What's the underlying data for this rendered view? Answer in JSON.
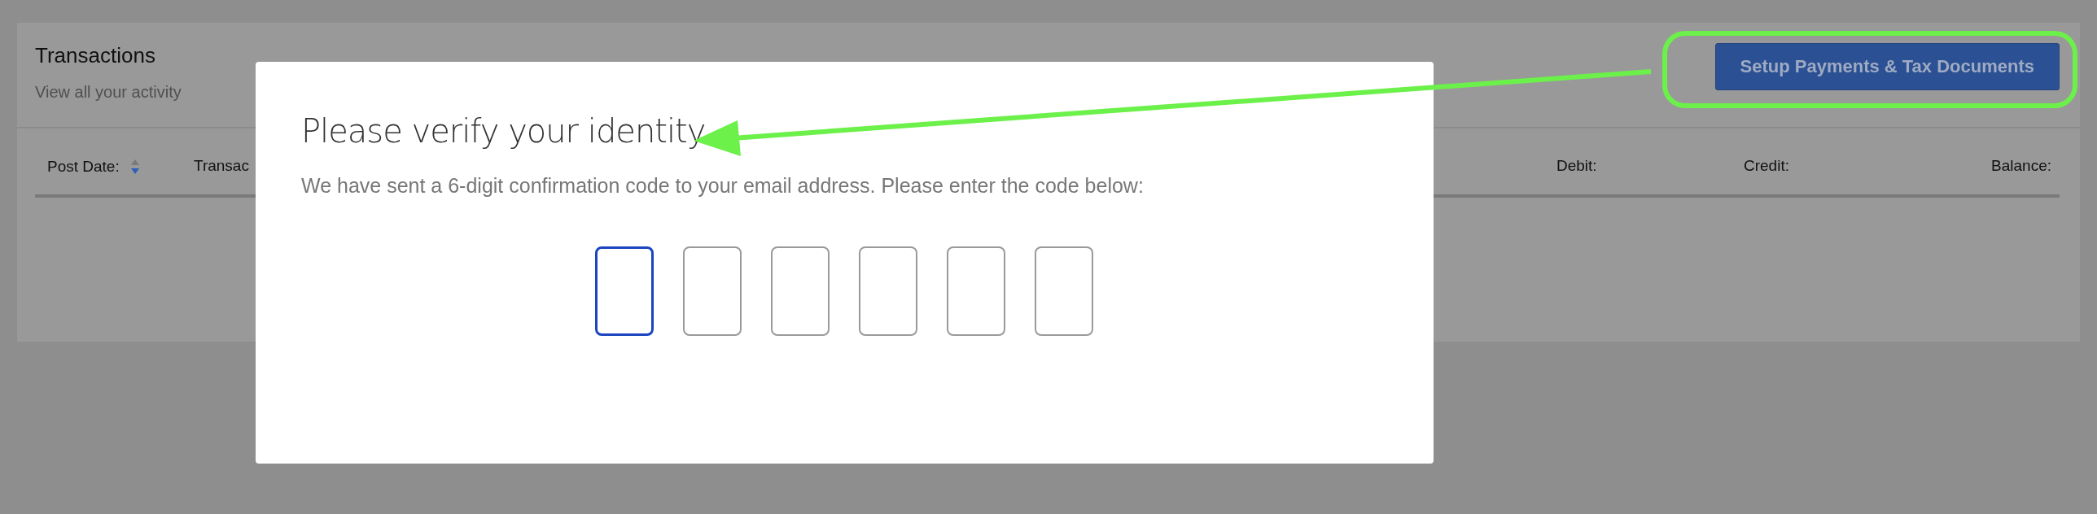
{
  "card": {
    "title": "Transactions",
    "subtitle": "View all your activity",
    "button": "Setup Payments & Tax Documents"
  },
  "columns": [
    {
      "label": "Post Date:",
      "sortable": true,
      "descending": true
    },
    {
      "label": "Transac",
      "sortable": false
    },
    {
      "label": "Debit:",
      "sortable": false
    },
    {
      "label": "Credit:",
      "sortable": false
    },
    {
      "label": "Balance:",
      "sortable": false
    }
  ],
  "modal": {
    "title": "Please verify your identity",
    "message": "We have sent a 6-digit confirmation code to your email address. Please enter the code below:",
    "code_inputs": [
      {
        "focused": true
      },
      {
        "focused": false
      },
      {
        "focused": false
      },
      {
        "focused": false
      },
      {
        "focused": false
      },
      {
        "focused": false
      }
    ]
  }
}
